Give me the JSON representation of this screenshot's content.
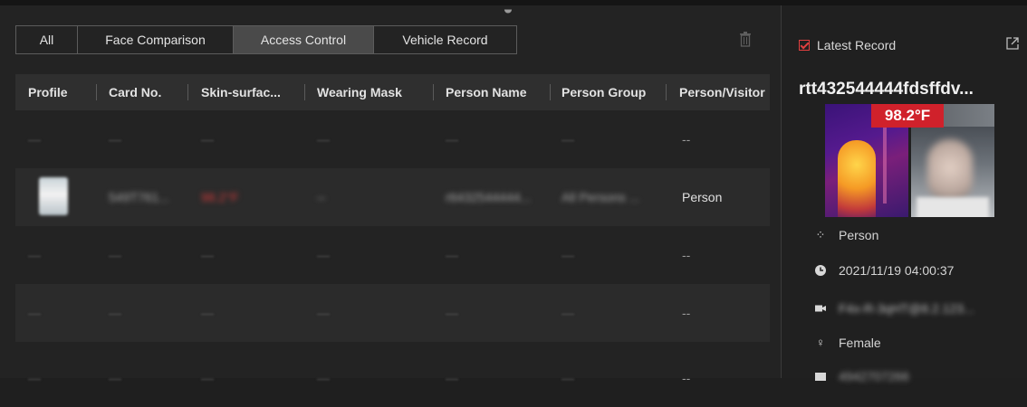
{
  "tabs": [
    {
      "label": "All",
      "active": false
    },
    {
      "label": "Face Comparison",
      "active": false
    },
    {
      "label": "Access Control",
      "active": true
    },
    {
      "label": "Vehicle Record",
      "active": false
    }
  ],
  "table": {
    "columns": [
      "Profile",
      "Card No.",
      "Skin-surfac...",
      "Wearing Mask",
      "Person Name",
      "Person Group",
      "Person/Visitor"
    ],
    "rows": [
      {
        "person_visitor": "--"
      },
      {
        "card_no": "549T761...",
        "skin_temp": "98.2°F",
        "wearing_mask": "--",
        "person_name": "rtt432544444...",
        "person_group": "All Persons ...",
        "person_visitor": "Person"
      },
      {
        "person_visitor": "--"
      },
      {
        "person_visitor": "--"
      },
      {
        "person_visitor": "--"
      }
    ]
  },
  "panel": {
    "latest_record_label": "Latest Record",
    "latest_record_checked": true,
    "record_title": "rtt432544444fdsffdv...",
    "temperature": "98.2°F",
    "person_type": "Person",
    "datetime": "2021/11/19 04:00:37",
    "device": "F4x-R-3qHT@8.2.123...",
    "gender": "Female",
    "id_number": "4942707266"
  },
  "colors": {
    "accent_red": "#d0212b",
    "active_tab": "#4a4a4a"
  }
}
